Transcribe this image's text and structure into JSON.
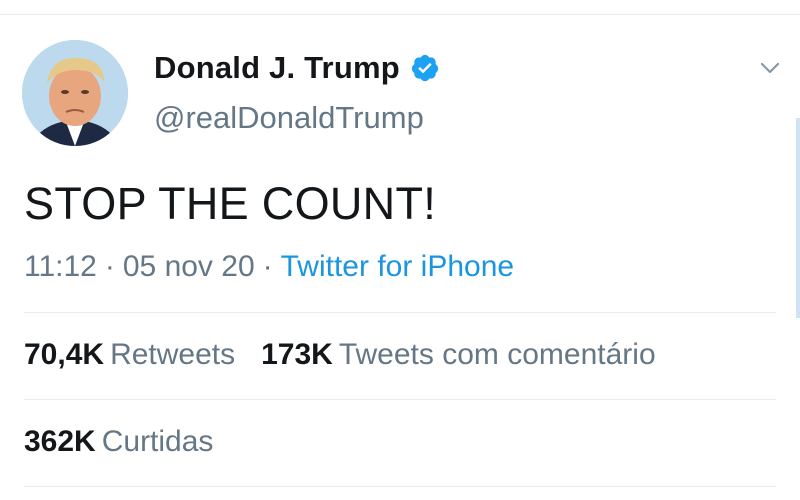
{
  "tweet": {
    "author": {
      "display_name": "Donald J. Trump",
      "handle": "@realDonaldTrump",
      "verified": true
    },
    "text": "STOP THE COUNT!",
    "time": "11:12",
    "separator": "·",
    "date": "05 nov 20",
    "source": "Twitter for iPhone"
  },
  "stats": {
    "retweets_count": "70,4K",
    "retweets_label": "Retweets",
    "quotes_count": "173K",
    "quotes_label": "Tweets com comentário",
    "likes_count": "362K",
    "likes_label": "Curtidas"
  },
  "icons": {
    "verified": "verified-badge-icon",
    "menu": "chevron-down-icon"
  },
  "colors": {
    "accent": "#1b95e0",
    "text_primary": "#14171a",
    "text_secondary": "#657786",
    "divider": "#e6ecf0"
  }
}
